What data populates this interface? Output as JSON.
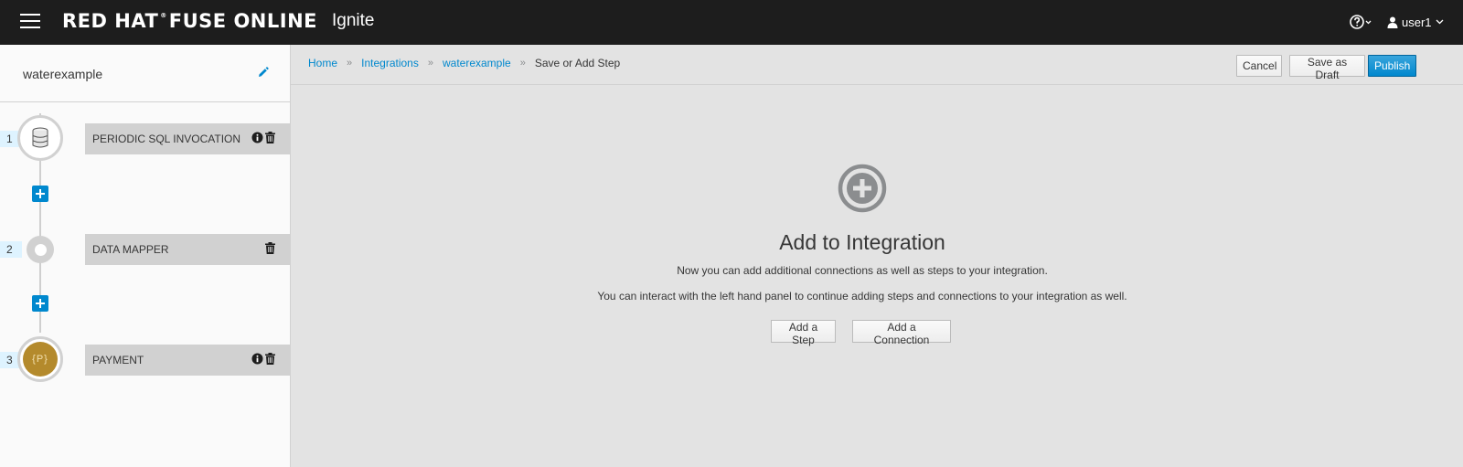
{
  "navbar": {
    "brand": "RED HAT",
    "brand_mark": "®",
    "brand_suffix": "FUSE ONLINE",
    "product": "Ignite",
    "user": "user1",
    "icons": {
      "menu": "hamburger-icon",
      "help": "question-circle-icon",
      "user": "user-icon",
      "caret": "chevron-down-icon"
    }
  },
  "sidebar": {
    "integration_name": "waterexample",
    "steps": [
      {
        "number": "1",
        "label": "PERIODIC SQL INVOCATION",
        "icon": "database-icon",
        "has_info": true
      },
      {
        "number": "2",
        "label": "DATA MAPPER",
        "icon": "mapper-dot-icon",
        "has_info": false
      },
      {
        "number": "3",
        "label": "PAYMENT",
        "icon": "api-badge-icon",
        "badge_text": "{P}",
        "has_info": true
      }
    ]
  },
  "breadcrumb": {
    "items": [
      "Home",
      "Integrations",
      "waterexample"
    ],
    "current": "Save or Add Step",
    "separator": "»"
  },
  "toolbar": {
    "cancel_label": "Cancel",
    "draft_label": "Save as Draft",
    "publish_label": "Publish"
  },
  "main": {
    "title": "Add to Integration",
    "line1": "Now you can add additional connections as well as steps to your integration.",
    "line2": "You can interact with the left hand panel to continue adding steps and connections to your integration as well.",
    "add_step_label": "Add a Step",
    "add_connection_label": "Add a Connection"
  },
  "colors": {
    "accent": "#0088ce",
    "navbar": "#1d1d1d",
    "badge": "#b48a2c"
  }
}
